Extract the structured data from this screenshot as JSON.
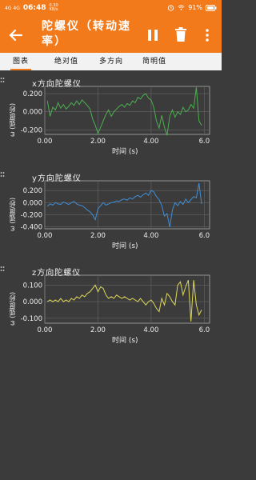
{
  "status": {
    "signal": "4G 4G",
    "time": "06:48",
    "net_speed": "0.30\nKB/s",
    "battery": "91%"
  },
  "appbar": {
    "title": "陀螺仪（转动速率）"
  },
  "tabs": [
    "图表",
    "绝对值",
    "多方向",
    "简明值"
  ],
  "x_axis": {
    "label": "时间 (s)",
    "ticks": [
      "0.00",
      "2.00",
      "4.00",
      "6.0"
    ]
  },
  "ylabel": "ω (弧度/秒)",
  "colors": {
    "accent": "#f27a1a",
    "x": "#4caf50",
    "y": "#3f8ed8",
    "z": "#e0d85a",
    "plot_bg": "#3b3b3b",
    "grid": "#666666"
  },
  "chart_data": [
    {
      "type": "line",
      "title": "x方向陀螺仪",
      "xlabel": "时间 (s)",
      "ylabel": "ω (弧度/秒)",
      "xlim": [
        0,
        6.2
      ],
      "ylim": [
        -0.25,
        0.28
      ],
      "yticks": [
        "0.200",
        "0.000",
        "-0.200"
      ],
      "ytick_values": [
        0.2,
        0.0,
        -0.2
      ],
      "x": [
        0.1,
        0.2,
        0.3,
        0.4,
        0.5,
        0.6,
        0.7,
        0.8,
        0.9,
        1.0,
        1.1,
        1.2,
        1.3,
        1.4,
        1.5,
        1.6,
        1.7,
        1.8,
        1.9,
        2.0,
        2.1,
        2.2,
        2.3,
        2.4,
        2.5,
        2.6,
        2.7,
        2.8,
        2.9,
        3.0,
        3.1,
        3.2,
        3.3,
        3.4,
        3.5,
        3.6,
        3.7,
        3.8,
        3.9,
        4.0,
        4.1,
        4.2,
        4.3,
        4.4,
        4.5,
        4.6,
        4.7,
        4.8,
        4.9,
        5.0,
        5.1,
        5.2,
        5.3,
        5.4,
        5.5,
        5.6,
        5.7,
        5.8,
        5.9
      ],
      "y": [
        0.12,
        -0.05,
        0.05,
        0.02,
        0.1,
        0.04,
        0.08,
        0.03,
        0.06,
        0.1,
        0.07,
        0.12,
        0.08,
        0.13,
        0.1,
        0.07,
        0.03,
        -0.08,
        -0.15,
        -0.24,
        -0.17,
        -0.1,
        -0.03,
        0.02,
        -0.05,
        0.0,
        0.03,
        0.06,
        0.08,
        0.05,
        0.09,
        0.07,
        0.12,
        0.1,
        0.16,
        0.14,
        0.18,
        0.2,
        0.15,
        0.13,
        0.05,
        -0.1,
        -0.18,
        -0.04,
        -0.17,
        -0.26,
        -0.05,
        0.02,
        -0.06,
        0.0,
        -0.03,
        0.05,
        0.0,
        0.02,
        0.08,
        0.04,
        0.27,
        -0.1,
        -0.15
      ],
      "grid": true
    },
    {
      "type": "line",
      "title": "y方向陀螺仪",
      "xlabel": "时间 (s)",
      "ylabel": "ω (弧度/秒)",
      "xlim": [
        0,
        6.2
      ],
      "ylim": [
        -0.43,
        0.36
      ],
      "yticks": [
        "0.200",
        "0.000",
        "-0.200",
        "-0.400"
      ],
      "ytick_values": [
        0.2,
        0.0,
        -0.2,
        -0.4
      ],
      "x": [
        0.1,
        0.2,
        0.3,
        0.4,
        0.5,
        0.6,
        0.7,
        0.8,
        0.9,
        1.0,
        1.1,
        1.2,
        1.3,
        1.4,
        1.5,
        1.6,
        1.7,
        1.8,
        1.9,
        2.0,
        2.1,
        2.2,
        2.3,
        2.4,
        2.5,
        2.6,
        2.7,
        2.8,
        2.9,
        3.0,
        3.1,
        3.2,
        3.3,
        3.4,
        3.5,
        3.6,
        3.7,
        3.8,
        3.9,
        4.0,
        4.1,
        4.2,
        4.3,
        4.4,
        4.5,
        4.6,
        4.7,
        4.8,
        4.9,
        5.0,
        5.1,
        5.2,
        5.3,
        5.4,
        5.5,
        5.6,
        5.7,
        5.8,
        5.9
      ],
      "y": [
        -0.06,
        -0.02,
        -0.04,
        0.0,
        -0.02,
        -0.03,
        0.01,
        -0.01,
        -0.03,
        0.0,
        0.02,
        -0.02,
        -0.04,
        -0.05,
        -0.08,
        -0.12,
        -0.15,
        -0.2,
        -0.28,
        -0.1,
        -0.05,
        0.0,
        -0.04,
        -0.02,
        0.0,
        0.01,
        0.03,
        0.02,
        0.05,
        0.06,
        0.04,
        0.08,
        0.06,
        0.1,
        0.12,
        0.09,
        0.13,
        0.16,
        0.12,
        0.2,
        0.18,
        0.1,
        0.05,
        -0.05,
        -0.22,
        -0.18,
        -0.4,
        -0.12,
        0.0,
        -0.05,
        0.02,
        -0.03,
        0.06,
        0.0,
        0.05,
        0.1,
        0.08,
        0.32,
        -0.02
      ],
      "grid": true
    },
    {
      "type": "line",
      "title": "z方向陀螺仪",
      "xlabel": "时间 (s)",
      "ylabel": "ω (弧度/秒)",
      "xlim": [
        0,
        6.2
      ],
      "ylim": [
        -0.13,
        0.16
      ],
      "yticks": [
        "0.100",
        "0.000",
        "-0.100"
      ],
      "ytick_values": [
        0.1,
        0.0,
        -0.1
      ],
      "x": [
        0.1,
        0.2,
        0.3,
        0.4,
        0.5,
        0.6,
        0.7,
        0.8,
        0.9,
        1.0,
        1.1,
        1.2,
        1.3,
        1.4,
        1.5,
        1.6,
        1.7,
        1.8,
        1.9,
        2.0,
        2.1,
        2.2,
        2.3,
        2.4,
        2.5,
        2.6,
        2.7,
        2.8,
        2.9,
        3.0,
        3.1,
        3.2,
        3.3,
        3.4,
        3.5,
        3.6,
        3.7,
        3.8,
        3.9,
        4.0,
        4.1,
        4.2,
        4.3,
        4.4,
        4.5,
        4.6,
        4.7,
        4.8,
        4.9,
        5.0,
        5.1,
        5.2,
        5.3,
        5.4,
        5.5,
        5.6,
        5.7,
        5.8,
        5.9
      ],
      "y": [
        0.0,
        0.01,
        0.0,
        0.01,
        0.0,
        0.02,
        0.0,
        0.01,
        0.0,
        0.02,
        0.01,
        0.03,
        0.02,
        0.04,
        0.03,
        0.05,
        0.06,
        0.08,
        0.1,
        0.06,
        0.09,
        0.08,
        0.04,
        0.02,
        0.03,
        0.02,
        0.04,
        0.03,
        0.02,
        0.03,
        0.02,
        0.01,
        0.02,
        0.01,
        0.0,
        0.02,
        0.0,
        -0.02,
        0.0,
        0.01,
        -0.01,
        -0.04,
        -0.06,
        0.02,
        -0.02,
        0.05,
        0.03,
        0.0,
        -0.02,
        0.1,
        0.12,
        0.04,
        0.09,
        0.13,
        -0.12,
        0.13,
        -0.02,
        -0.08,
        -0.05
      ],
      "grid": true
    }
  ]
}
